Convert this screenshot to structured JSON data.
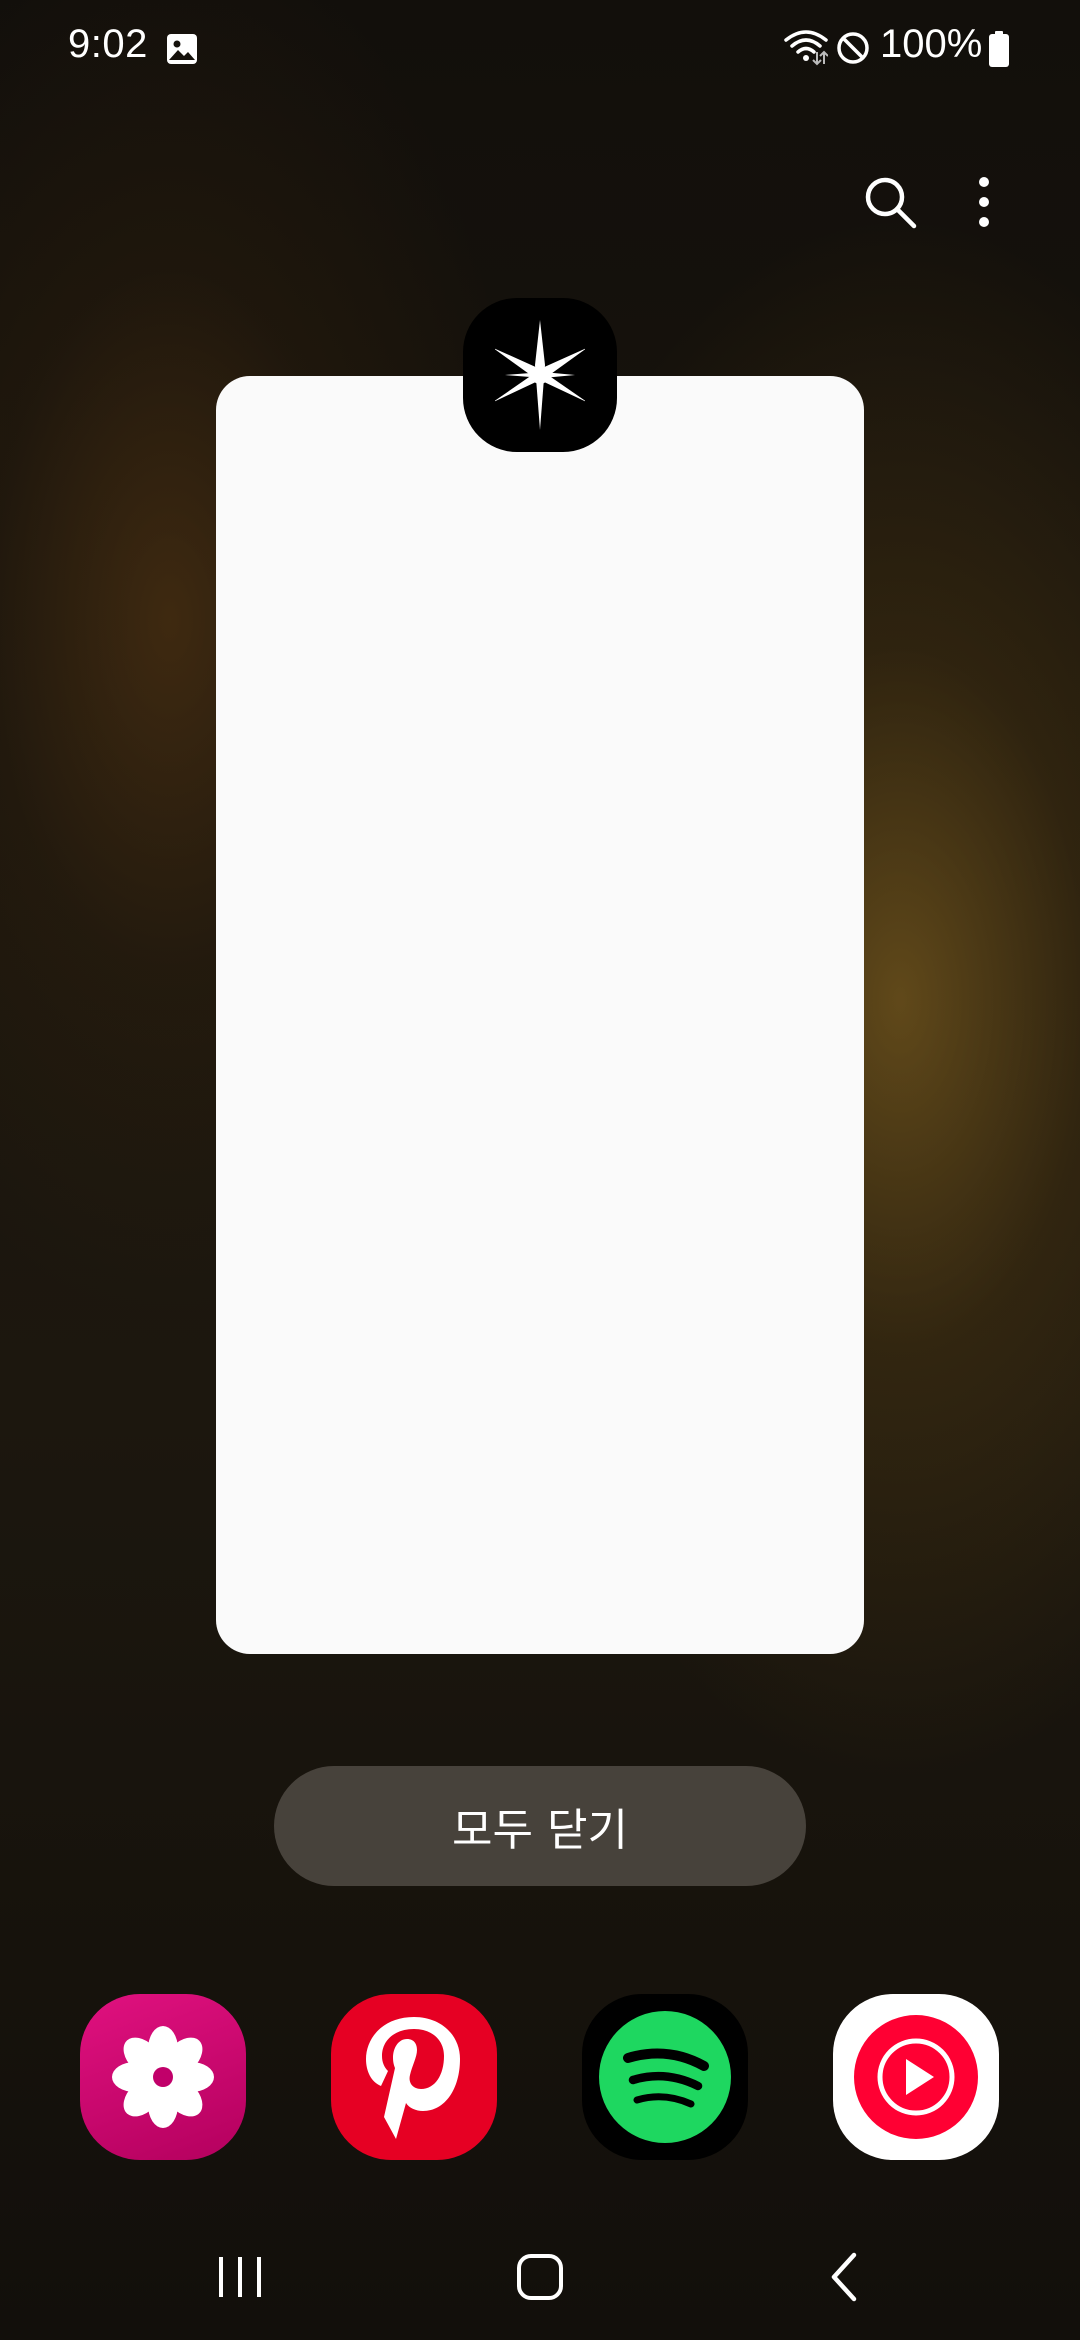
{
  "status_bar": {
    "time": "9:02",
    "battery_percent": "100%",
    "icons": [
      "gallery-icon",
      "wifi-icon",
      "do-not-disturb-icon",
      "battery-icon"
    ]
  },
  "top_actions": {
    "icons": [
      "search-icon",
      "more-options-icon"
    ]
  },
  "recent_app": {
    "icon": "sparkle-app-icon",
    "icon_color": "#000000"
  },
  "close_all_button": {
    "label": "모두 닫기"
  },
  "suggested_apps": [
    {
      "icon": "blossom-app-icon",
      "color": "#d0036e"
    },
    {
      "icon": "pinterest-icon",
      "color": "#e60023"
    },
    {
      "icon": "spotify-icon",
      "color": "#1ed760"
    },
    {
      "icon": "youtube-music-icon",
      "color": "#ff0033"
    }
  ],
  "navigation": {
    "icons": [
      "recents-icon",
      "home-icon",
      "back-icon"
    ]
  }
}
